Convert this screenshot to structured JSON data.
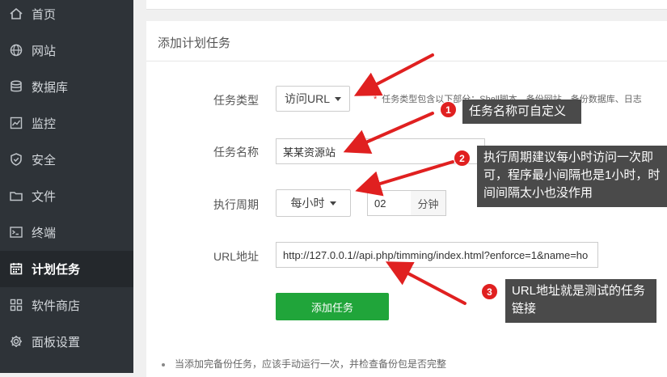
{
  "sidebar": {
    "items": [
      {
        "label": "首页",
        "icon": "home-icon"
      },
      {
        "label": "网站",
        "icon": "globe-icon"
      },
      {
        "label": "数据库",
        "icon": "database-icon"
      },
      {
        "label": "监控",
        "icon": "monitor-chart-icon"
      },
      {
        "label": "安全",
        "icon": "shield-icon"
      },
      {
        "label": "文件",
        "icon": "folder-icon"
      },
      {
        "label": "终端",
        "icon": "terminal-icon"
      },
      {
        "label": "计划任务",
        "icon": "calendar-icon",
        "active": true
      },
      {
        "label": "软件商店",
        "icon": "grid-icon"
      },
      {
        "label": "面板设置",
        "icon": "gear-icon"
      }
    ]
  },
  "panel": {
    "title": "添加计划任务"
  },
  "form": {
    "task_type": {
      "label": "任务类型",
      "value": "访问URL"
    },
    "task_type_hint": "任务类型包含以下部分：Shell脚本、备份网站、备份数据库、日志",
    "task_name": {
      "label": "任务名称",
      "value": "某某资源站"
    },
    "period": {
      "label": "执行周期",
      "value": "每小时",
      "minute": "02",
      "minute_unit": "分钟"
    },
    "url": {
      "label": "URL地址",
      "value": "http://127.0.0.1//api.php/timming/index.html?enforce=1&name=ho"
    },
    "submit_label": "添加任务"
  },
  "note": "当添加完备份任务，应该手动运行一次，并检查备份包是否完整",
  "annotations": [
    {
      "number": "1",
      "text": "任务名称可自定义"
    },
    {
      "number": "2",
      "text": "执行周期建议每小时访问一次即可，程序最小间隔也是1小时，时间间隔太小也没作用"
    },
    {
      "number": "3",
      "text": "URL地址就是测试的任务链接"
    }
  ],
  "colors": {
    "sidebar_bg": "#2e3338",
    "accent_green": "#20a53a",
    "arrow_red": "#e02020",
    "callout_bg": "#4a4a4a"
  }
}
